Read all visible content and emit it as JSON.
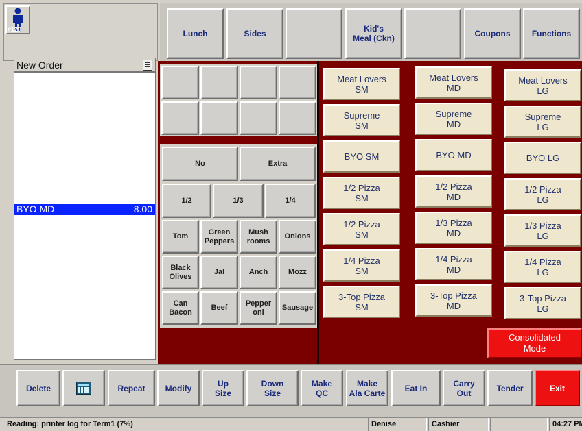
{
  "terminal": {
    "badge": "#120",
    "icon": "person-icon"
  },
  "categories": [
    {
      "label": "Lunch"
    },
    {
      "label": "Sides"
    },
    {
      "label": ""
    },
    {
      "label": "Kid's\nMeal (Ckn)"
    },
    {
      "label": ""
    },
    {
      "label": "Coupons"
    },
    {
      "label": "Functions"
    }
  ],
  "order": {
    "title": "New Order",
    "items": [
      {
        "name": "BYO MD",
        "price": "8.00"
      }
    ]
  },
  "modifiers": {
    "quantity": [
      "No",
      "Extra"
    ],
    "portions": [
      "1/2",
      "1/3",
      "1/4"
    ],
    "toppings": [
      "Tom",
      "Green\nPeppers",
      "Mush\nrooms",
      "Onions",
      "Black\nOlives",
      "Jal",
      "Anch",
      "Mozz",
      "Can\nBacon",
      "Beef",
      "Pepper\noni",
      "Sausage"
    ]
  },
  "pizzas": {
    "sm": [
      "Meat Lovers\nSM",
      "Supreme\nSM",
      "BYO SM",
      "1/2 Pizza\nSM",
      "1/2 Pizza\nSM",
      "1/4 Pizza\nSM",
      "3-Top Pizza\nSM"
    ],
    "md": [
      "Meat Lovers\nMD",
      "Supreme\nMD",
      "BYO MD",
      "1/2 Pizza\nMD",
      "1/3 Pizza\nMD",
      "1/4 Pizza\nMD",
      "3-Top Pizza\nMD"
    ],
    "lg": [
      "Meat Lovers\nLG",
      "Supreme\nLG",
      "BYO LG",
      "1/2 Pizza\nLG",
      "1/3 Pizza\nLG",
      "1/4 Pizza\nLG",
      "3-Top Pizza\nLG"
    ]
  },
  "consolidated_mode": "Consolidated\nMode",
  "actions": {
    "delete": "Delete",
    "keypad_icon": "calculator-icon",
    "repeat": "Repeat",
    "modify": "Modify",
    "up_size": "Up\nSize",
    "down_size": "Down\nSize",
    "make_qc": "Make\nQC",
    "make_ala_carte": "Make\nAla Carte",
    "eat_in": "Eat In",
    "carry_out": "Carry\nOut",
    "tender": "Tender",
    "exit": "Exit"
  },
  "status": {
    "message": "Reading: printer log for Term1 (7%)",
    "user": "Denise",
    "role": "Cashier",
    "extra": "",
    "time": "04:27 PM"
  },
  "colors": {
    "accent_red": "#ee1111",
    "panel_red": "#7a0000",
    "selection_blue": "#0a24ff"
  }
}
